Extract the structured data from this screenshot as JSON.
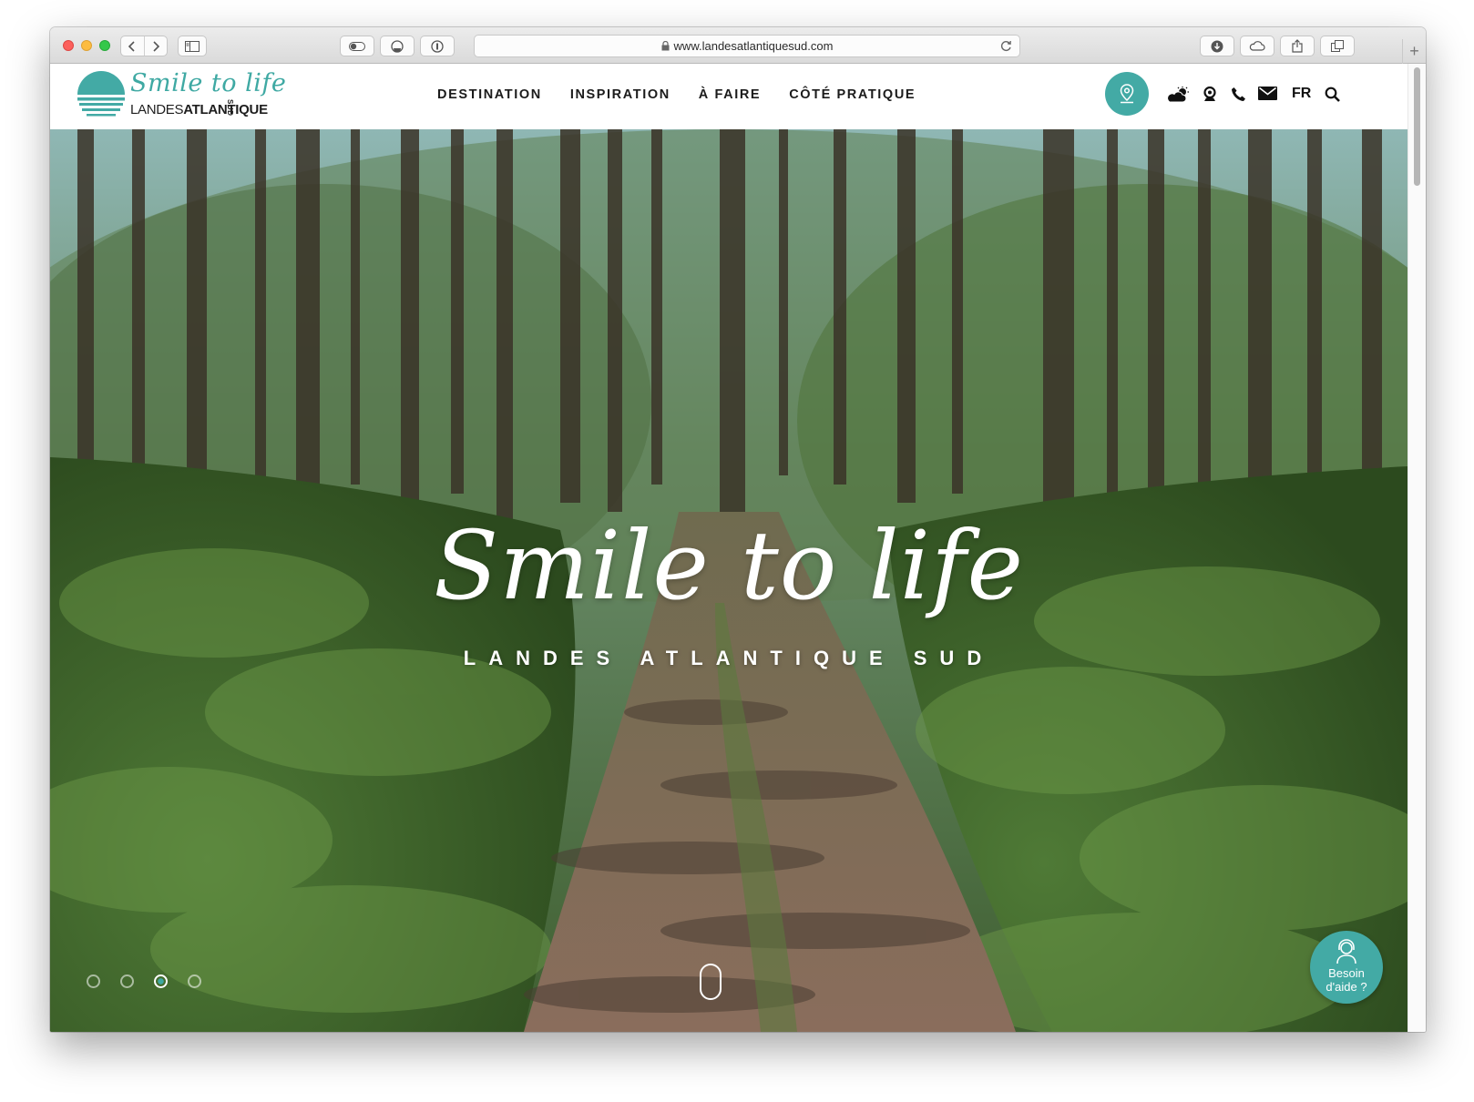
{
  "browser": {
    "url": "www.landesatlantiquesud.com",
    "new_tab_label": "+"
  },
  "site": {
    "logo_script": "Smile to life",
    "logo_sub_light": "LANDES",
    "logo_sub_bold": "ATLANTIQUE",
    "logo_sud": "SUD",
    "nav": [
      {
        "label": "DESTINATION"
      },
      {
        "label": "INSPIRATION"
      },
      {
        "label": "À FAIRE"
      },
      {
        "label": "CÔTÉ PRATIQUE"
      }
    ],
    "language": "FR",
    "icons": [
      "map-pin-icon",
      "weather-icon",
      "webcam-icon",
      "phone-icon",
      "mail-icon",
      "search-icon"
    ],
    "accent_color": "#43aaa5"
  },
  "hero": {
    "title": "Smile to life",
    "subtitle": "LANDES ATLANTIQUE SUD",
    "slides_count": 4,
    "active_slide": 3,
    "help_line1": "Besoin",
    "help_line2": "d'aide ?"
  }
}
